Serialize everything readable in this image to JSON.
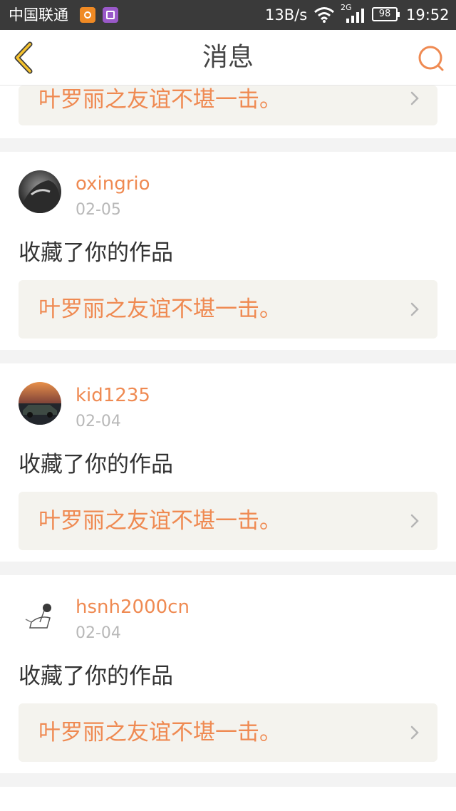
{
  "status_bar": {
    "carrier": "中国联通",
    "speed": "13B/s",
    "network": "2G",
    "battery": "98",
    "time": "19:52"
  },
  "nav": {
    "title": "消息",
    "back_icon": "chevron-left-icon",
    "search_icon": "search-icon"
  },
  "colors": {
    "accent": "#ef8a52",
    "link_bg": "#f4f3ee",
    "date": "#b8b8b8",
    "text": "#333333"
  },
  "feed": {
    "top_partial": {
      "work_title": "叶罗丽之友谊不堪一击。"
    },
    "items": [
      {
        "username": "oxingrio",
        "date": "02-05",
        "action": "收藏了你的作品",
        "work_title": "叶罗丽之友谊不堪一击。"
      },
      {
        "username": "kid1235",
        "date": "02-04",
        "action": "收藏了你的作品",
        "work_title": "叶罗丽之友谊不堪一击。"
      },
      {
        "username": "hsnh2000cn",
        "date": "02-04",
        "action": "收藏了你的作品",
        "work_title": "叶罗丽之友谊不堪一击。"
      }
    ]
  }
}
